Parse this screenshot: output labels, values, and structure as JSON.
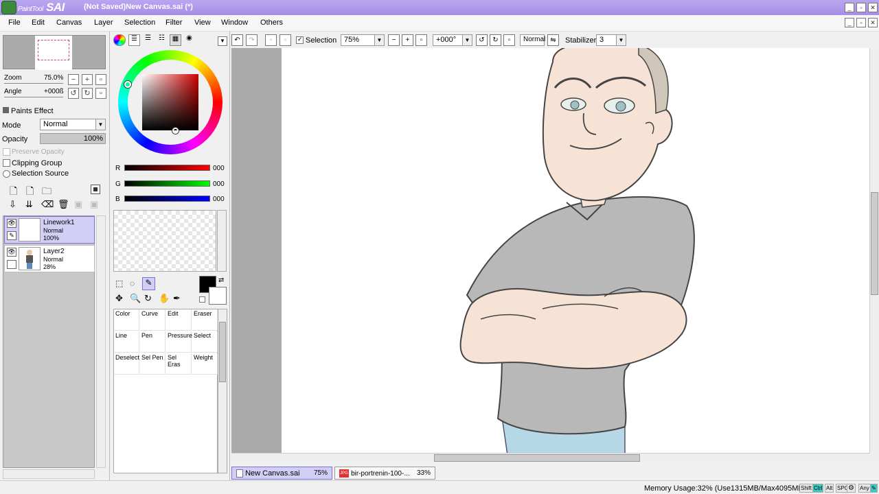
{
  "app": {
    "logo_small": "PaintTool",
    "logo_big": "SAI",
    "window_title": "(Not Saved)New Canvas.sai (*)"
  },
  "menu": [
    "File",
    "Edit",
    "Canvas",
    "Layer",
    "Selection",
    "Filter",
    "View",
    "Window",
    "Others"
  ],
  "navigator": {
    "zoom_label": "Zoom",
    "zoom_value": "75.0%",
    "angle_label": "Angle",
    "angle_value": "+000ß"
  },
  "paints_effect": {
    "header": "Paints Effect",
    "mode_label": "Mode",
    "mode_value": "Normal",
    "opacity_label": "Opacity",
    "opacity_value": "100%",
    "preserve_opacity": "Preserve Opacity",
    "clipping_group": "Clipping Group",
    "selection_source": "Selection Source"
  },
  "layers": [
    {
      "name": "Linework1",
      "mode": "Normal",
      "opacity": "100%",
      "selected": true
    },
    {
      "name": "Layer2",
      "mode": "Normal",
      "opacity": "28%",
      "selected": false
    }
  ],
  "color": {
    "r_label": "R",
    "g_label": "G",
    "b_label": "B",
    "r_value": "000",
    "g_value": "000",
    "b_value": "000",
    "primary": "#000000",
    "secondary": "#ffffff"
  },
  "tools": [
    {
      "label": "Color"
    },
    {
      "label": "Curve"
    },
    {
      "label": "Edit"
    },
    {
      "label": "Eraser"
    },
    {
      "label": "Line"
    },
    {
      "label": "Pen"
    },
    {
      "label": "Pressure"
    },
    {
      "label": "Select"
    },
    {
      "label": "Deselect"
    },
    {
      "label": "Sel Pen"
    },
    {
      "label": "Sel Eras"
    },
    {
      "label": "Weight"
    }
  ],
  "toolbar": {
    "selection_label": "Selection",
    "zoom_value": "75%",
    "angle_value": "+000°",
    "blend_mode": "Normal",
    "stabilizer_label": "Stabilizer",
    "stabilizer_value": "3"
  },
  "tabs": [
    {
      "name": "New Canvas.sai",
      "zoom": "75%"
    },
    {
      "name": "bir-portrenin-100-...",
      "zoom": "33%"
    }
  ],
  "status": {
    "memory": "Memory Usage:32% (Use1315MB/Max4095MB)",
    "keys": [
      "Shift",
      "Ctrl",
      "Alt",
      "SPC",
      "Any"
    ]
  },
  "colors": {
    "titlebar": "#a48ee6",
    "selected_layer": "#d2cff6",
    "active_tab": "#d2cff6"
  }
}
